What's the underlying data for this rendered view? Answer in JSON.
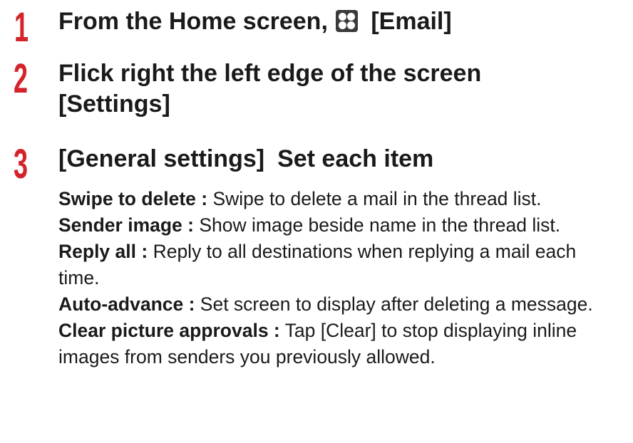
{
  "steps": [
    {
      "number": "1",
      "text_before_icon": "From the Home screen,",
      "icon": "apps-icon",
      "text_after_icon": "[Email]"
    },
    {
      "number": "2",
      "line1": "Flick right the left edge of the screen",
      "line2": "[Settings]"
    },
    {
      "number": "3",
      "title_part1": "[General settings]",
      "title_part2": "Set each item"
    }
  ],
  "items": [
    {
      "name": "Swipe to delete :",
      "description": "Swipe to delete a mail in the thread list."
    },
    {
      "name": "Sender image :",
      "description": "Show image beside name in the thread list."
    },
    {
      "name": "Reply all :",
      "description": "Reply to all destinations when replying a mail each time."
    },
    {
      "name": "Auto-advance :",
      "description": "Set screen to display after deleting a message."
    },
    {
      "name": "Clear picture approvals :",
      "description": "Tap [Clear] to stop displaying inline images from senders you previously allowed."
    }
  ],
  "colors": {
    "step_number": "#d4232b",
    "text": "#1a1a1a"
  }
}
